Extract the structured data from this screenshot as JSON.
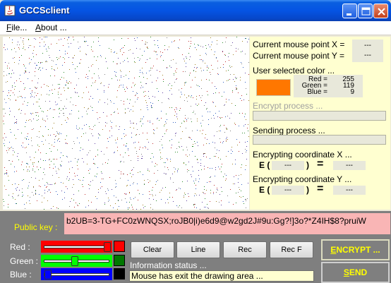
{
  "window": {
    "title": "GCCSclient"
  },
  "menu": {
    "file": {
      "accel": "F",
      "rest": "ile..."
    },
    "about": {
      "accel": "A",
      "rest": "bout ..."
    }
  },
  "info_panel": {
    "mouse_x_label": "Current mouse point X =",
    "mouse_x_value": "---",
    "mouse_y_label": "Current mouse point Y =",
    "mouse_y_value": "---",
    "user_color_label": "User selected color ...",
    "selected_color": "#FF7700",
    "red_key": "Red =",
    "red_value": "255",
    "green_key": "Green =",
    "green_value": "119",
    "blue_key": "Blue =",
    "blue_value": "9",
    "encrypt_process_label": "Encrypt process ...",
    "sending_process_label": "Sending process ...",
    "enc_x_label": "Encrypting coordinate X ...",
    "enc_y_label": "Encrypting coordinate Y ...",
    "e_open": "E (",
    "e_close": ")",
    "equals": "=",
    "enc_x_in": "---",
    "enc_x_out": "---",
    "enc_y_in": "---",
    "enc_y_out": "---"
  },
  "public_key": {
    "label": "Public key :",
    "value": "b2UB=3-TG+FC0zWNQSX;roJB0|i)e6d9@w2gd2J#9u:Gg?!]3o?*Z4IH$8?pruiW"
  },
  "controls": {
    "red_label": "Red :",
    "green_label": "Green :",
    "blue_label": "Blue :",
    "red_level": 1.0,
    "green_level": 0.47,
    "blue_level": 0.04,
    "red_color": "#FF0000",
    "green_color": "#00FF00",
    "blue_color": "#0000FF",
    "red_chip": "#FF0000",
    "green_chip": "#007700",
    "blue_chip": "#000000",
    "buttons": [
      "Clear",
      "Line",
      "Rec",
      "Rec F"
    ],
    "info_status_label": "Information status ...",
    "info_status_value": "Mouse has exit the drawing area ...",
    "encrypt": {
      "accel": "E",
      "rest": "NCRYPT ..."
    },
    "send": {
      "accel": "S",
      "rest": "END"
    }
  }
}
